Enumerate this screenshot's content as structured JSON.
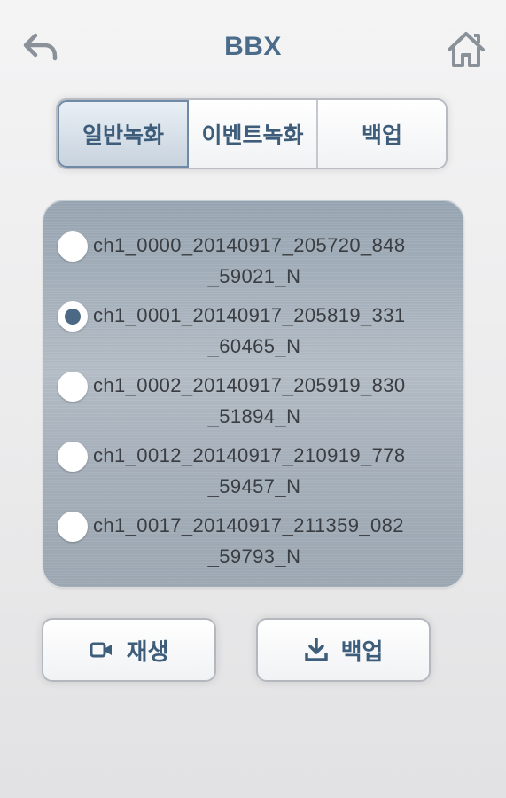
{
  "header": {
    "title": "BBX",
    "back_icon": "back-arrow-icon",
    "home_icon": "home-icon"
  },
  "tabs": [
    {
      "label": "일반녹화",
      "active": true
    },
    {
      "label": "이벤트녹화",
      "active": false
    },
    {
      "label": "백업",
      "active": false
    }
  ],
  "files": [
    {
      "line1": "ch1_0000_20140917_205720_848",
      "line2": "_59021_N",
      "selected": false
    },
    {
      "line1": "ch1_0001_20140917_205819_331",
      "line2": "_60465_N",
      "selected": true
    },
    {
      "line1": "ch1_0002_20140917_205919_830",
      "line2": "_51894_N",
      "selected": false
    },
    {
      "line1": "ch1_0012_20140917_210919_778",
      "line2": "_59457_N",
      "selected": false
    },
    {
      "line1": "ch1_0017_20140917_211359_082",
      "line2": "_59793_N",
      "selected": false
    }
  ],
  "actions": {
    "play_label": "재생",
    "play_icon": "video-camera-icon",
    "backup_label": "백업",
    "backup_icon": "download-icon"
  },
  "colors": {
    "accent": "#4a6b89",
    "panel": "#a5afba",
    "selected_dot": "#4b6884"
  }
}
